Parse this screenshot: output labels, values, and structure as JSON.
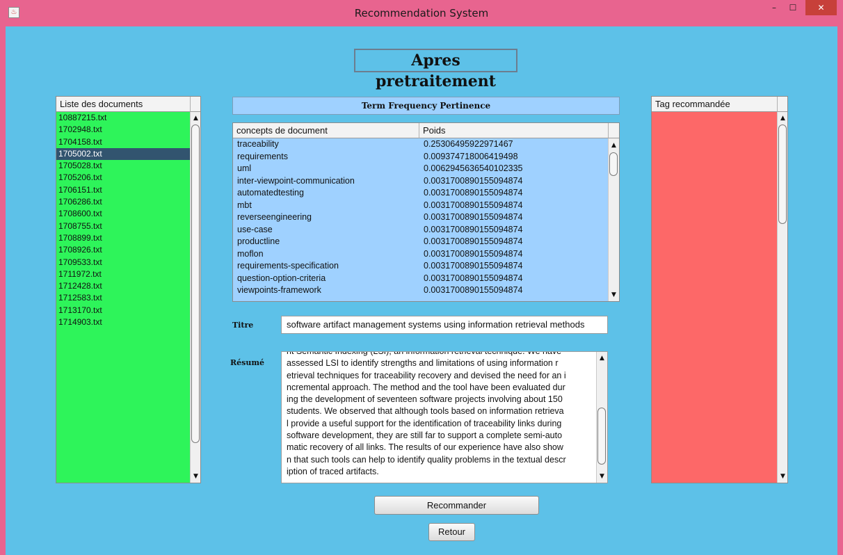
{
  "window": {
    "title": "Recommendation System",
    "app_icon": "java-cup-icon",
    "minimize_glyph": "–",
    "maximize_glyph": "☐",
    "close_glyph": "✕"
  },
  "heading": "Apres pretraitement",
  "documents": {
    "header": "Liste des documents",
    "items": [
      "10887215.txt",
      "1702948.txt",
      "1704158.txt",
      "1705002.txt",
      "1705028.txt",
      "1705206.txt",
      "1706151.txt",
      "1706286.txt",
      "1708600.txt",
      "1708755.txt",
      "1708899.txt",
      "1708926.txt",
      "1709533.txt",
      "1711972.txt",
      "1712428.txt",
      "1712583.txt",
      "1713170.txt",
      "1714903.txt"
    ],
    "selected": "1705002.txt",
    "background": "#2ef45a"
  },
  "term_frequency": {
    "title": "Term Frequency Pertinence",
    "columns": [
      "concepts de document",
      "Poids"
    ],
    "rows": [
      [
        "traceability",
        "0.25306495922971467"
      ],
      [
        "requirements",
        "0.009374718006419498"
      ],
      [
        "uml",
        "0.0062945636540102335"
      ],
      [
        "inter-viewpoint-communication",
        "0.0031700890155094874"
      ],
      [
        "automatedtesting",
        "0.0031700890155094874"
      ],
      [
        "mbt",
        "0.0031700890155094874"
      ],
      [
        "reverseengineering",
        "0.0031700890155094874"
      ],
      [
        "use-case",
        "0.0031700890155094874"
      ],
      [
        "productline",
        "0.0031700890155094874"
      ],
      [
        "moflon",
        "0.0031700890155094874"
      ],
      [
        "requirements-specification",
        "0.0031700890155094874"
      ],
      [
        "question-option-criteria",
        "0.0031700890155094874"
      ],
      [
        "viewpoints-framework",
        "0.0031700890155094874"
      ]
    ],
    "background": "#9fd1ff"
  },
  "titre": {
    "label": "Titre",
    "value": "software artifact management systems using information retrieval methods"
  },
  "resume": {
    "label": "Résumé",
    "lines": [
      "nt Semantic Indexing (LSI), an information retrieval technique. We have",
      "assessed LSI to identify strengths and limitations of using information r",
      "etrieval techniques for traceability recovery and devised the need for an i",
      "ncremental approach. The method and the tool have been evaluated dur",
      "ing the development of seventeen software projects involving about 150",
      "students. We observed that although tools based on information retrieva",
      "l provide a useful support for the identification of traceability links during",
      "software development, they are still far to support a complete semi-auto",
      "matic recovery of all links. The results of our experience have also show",
      "n that such tools can help to identify quality problems in the textual descr",
      "iption of traced artifacts."
    ]
  },
  "tags": {
    "header": "Tag recommandée",
    "background": "#fd6868"
  },
  "buttons": {
    "recommend": "Recommander",
    "back": "Retour"
  },
  "colors": {
    "titlebar": "#e8648f",
    "client": "#5dc1e8",
    "selection": "#32546f"
  }
}
